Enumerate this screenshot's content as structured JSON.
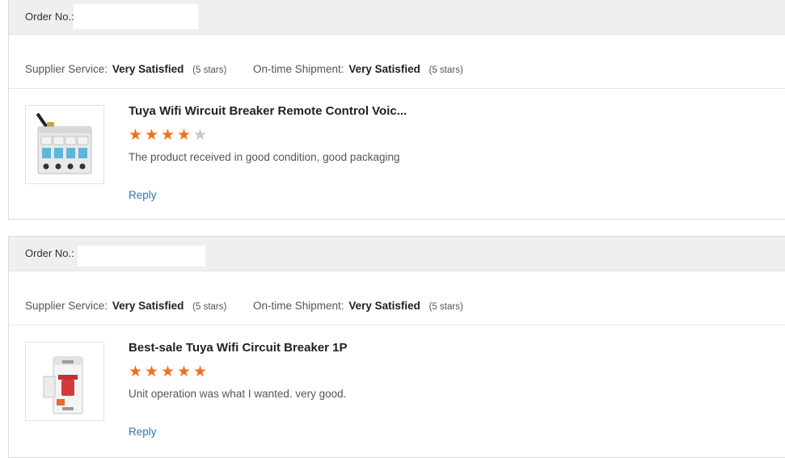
{
  "orders": [
    {
      "order_label": "Order No.:",
      "order_value": "",
      "supplier_service_label": "Supplier Service:",
      "supplier_service_value": "Very Satisfied",
      "supplier_service_stars": "(5 stars)",
      "shipment_label": "On-time Shipment:",
      "shipment_value": "Very Satisfied",
      "shipment_stars": "(5 stars)",
      "product_title": "Tuya Wifi Wircuit Breaker Remote Control Voic...",
      "product_image_icon": "wifi-circuit-breaker-4p-image",
      "rating": 4,
      "rating_max": 5,
      "comment": "The product received in good condition, good packaging",
      "reply_label": "Reply"
    },
    {
      "order_label": "Order No.:",
      "order_value": "",
      "supplier_service_label": "Supplier Service:",
      "supplier_service_value": "Very Satisfied",
      "supplier_service_stars": "(5 stars)",
      "shipment_label": "On-time Shipment:",
      "shipment_value": "Very Satisfied",
      "shipment_stars": "(5 stars)",
      "product_title": "Best-sale Tuya Wifi Circuit Breaker 1P",
      "product_image_icon": "circuit-breaker-1p-image",
      "rating": 5,
      "rating_max": 5,
      "comment": "Unit operation was what I wanted. very good.",
      "reply_label": "Reply"
    }
  ],
  "colors": {
    "star_filled": "#f0701e",
    "star_empty": "#c8c8c8",
    "link": "#2a7ab0",
    "order_bar_bg": "#efefef"
  }
}
